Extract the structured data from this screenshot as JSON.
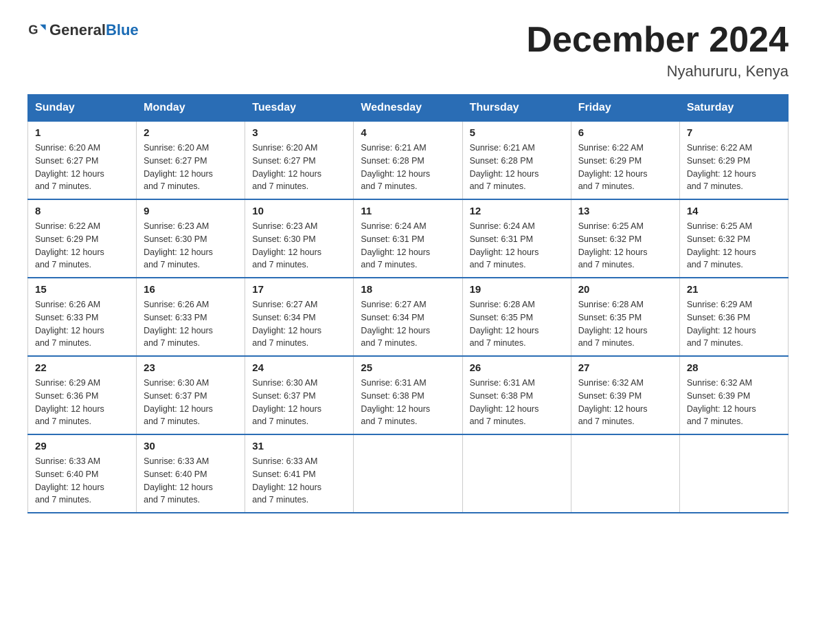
{
  "logo": {
    "text_general": "General",
    "text_blue": "Blue"
  },
  "header": {
    "title": "December 2024",
    "subtitle": "Nyahururu, Kenya"
  },
  "days_of_week": [
    "Sunday",
    "Monday",
    "Tuesday",
    "Wednesday",
    "Thursday",
    "Friday",
    "Saturday"
  ],
  "weeks": [
    [
      {
        "day": "1",
        "sunrise": "6:20 AM",
        "sunset": "6:27 PM",
        "daylight": "12 hours and 7 minutes."
      },
      {
        "day": "2",
        "sunrise": "6:20 AM",
        "sunset": "6:27 PM",
        "daylight": "12 hours and 7 minutes."
      },
      {
        "day": "3",
        "sunrise": "6:20 AM",
        "sunset": "6:27 PM",
        "daylight": "12 hours and 7 minutes."
      },
      {
        "day": "4",
        "sunrise": "6:21 AM",
        "sunset": "6:28 PM",
        "daylight": "12 hours and 7 minutes."
      },
      {
        "day": "5",
        "sunrise": "6:21 AM",
        "sunset": "6:28 PM",
        "daylight": "12 hours and 7 minutes."
      },
      {
        "day": "6",
        "sunrise": "6:22 AM",
        "sunset": "6:29 PM",
        "daylight": "12 hours and 7 minutes."
      },
      {
        "day": "7",
        "sunrise": "6:22 AM",
        "sunset": "6:29 PM",
        "daylight": "12 hours and 7 minutes."
      }
    ],
    [
      {
        "day": "8",
        "sunrise": "6:22 AM",
        "sunset": "6:29 PM",
        "daylight": "12 hours and 7 minutes."
      },
      {
        "day": "9",
        "sunrise": "6:23 AM",
        "sunset": "6:30 PM",
        "daylight": "12 hours and 7 minutes."
      },
      {
        "day": "10",
        "sunrise": "6:23 AM",
        "sunset": "6:30 PM",
        "daylight": "12 hours and 7 minutes."
      },
      {
        "day": "11",
        "sunrise": "6:24 AM",
        "sunset": "6:31 PM",
        "daylight": "12 hours and 7 minutes."
      },
      {
        "day": "12",
        "sunrise": "6:24 AM",
        "sunset": "6:31 PM",
        "daylight": "12 hours and 7 minutes."
      },
      {
        "day": "13",
        "sunrise": "6:25 AM",
        "sunset": "6:32 PM",
        "daylight": "12 hours and 7 minutes."
      },
      {
        "day": "14",
        "sunrise": "6:25 AM",
        "sunset": "6:32 PM",
        "daylight": "12 hours and 7 minutes."
      }
    ],
    [
      {
        "day": "15",
        "sunrise": "6:26 AM",
        "sunset": "6:33 PM",
        "daylight": "12 hours and 7 minutes."
      },
      {
        "day": "16",
        "sunrise": "6:26 AM",
        "sunset": "6:33 PM",
        "daylight": "12 hours and 7 minutes."
      },
      {
        "day": "17",
        "sunrise": "6:27 AM",
        "sunset": "6:34 PM",
        "daylight": "12 hours and 7 minutes."
      },
      {
        "day": "18",
        "sunrise": "6:27 AM",
        "sunset": "6:34 PM",
        "daylight": "12 hours and 7 minutes."
      },
      {
        "day": "19",
        "sunrise": "6:28 AM",
        "sunset": "6:35 PM",
        "daylight": "12 hours and 7 minutes."
      },
      {
        "day": "20",
        "sunrise": "6:28 AM",
        "sunset": "6:35 PM",
        "daylight": "12 hours and 7 minutes."
      },
      {
        "day": "21",
        "sunrise": "6:29 AM",
        "sunset": "6:36 PM",
        "daylight": "12 hours and 7 minutes."
      }
    ],
    [
      {
        "day": "22",
        "sunrise": "6:29 AM",
        "sunset": "6:36 PM",
        "daylight": "12 hours and 7 minutes."
      },
      {
        "day": "23",
        "sunrise": "6:30 AM",
        "sunset": "6:37 PM",
        "daylight": "12 hours and 7 minutes."
      },
      {
        "day": "24",
        "sunrise": "6:30 AM",
        "sunset": "6:37 PM",
        "daylight": "12 hours and 7 minutes."
      },
      {
        "day": "25",
        "sunrise": "6:31 AM",
        "sunset": "6:38 PM",
        "daylight": "12 hours and 7 minutes."
      },
      {
        "day": "26",
        "sunrise": "6:31 AM",
        "sunset": "6:38 PM",
        "daylight": "12 hours and 7 minutes."
      },
      {
        "day": "27",
        "sunrise": "6:32 AM",
        "sunset": "6:39 PM",
        "daylight": "12 hours and 7 minutes."
      },
      {
        "day": "28",
        "sunrise": "6:32 AM",
        "sunset": "6:39 PM",
        "daylight": "12 hours and 7 minutes."
      }
    ],
    [
      {
        "day": "29",
        "sunrise": "6:33 AM",
        "sunset": "6:40 PM",
        "daylight": "12 hours and 7 minutes."
      },
      {
        "day": "30",
        "sunrise": "6:33 AM",
        "sunset": "6:40 PM",
        "daylight": "12 hours and 7 minutes."
      },
      {
        "day": "31",
        "sunrise": "6:33 AM",
        "sunset": "6:41 PM",
        "daylight": "12 hours and 7 minutes."
      },
      null,
      null,
      null,
      null
    ]
  ]
}
